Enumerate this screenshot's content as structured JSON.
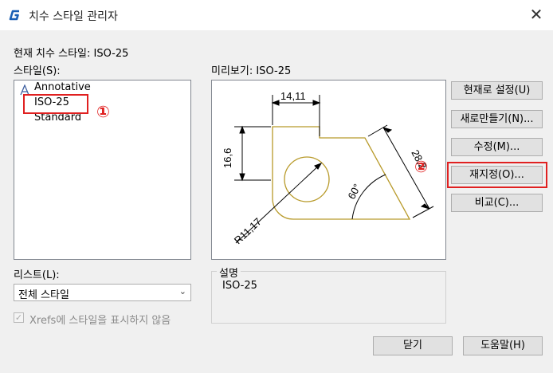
{
  "window": {
    "title": "치수 스타일 관리자",
    "close": "✕"
  },
  "current_style": "현재 치수 스타일: ISO-25",
  "styles_label": "스타일(S):",
  "styles": [
    "Annotative",
    "ISO-25",
    "Standard"
  ],
  "preview_label": "미리보기: ISO-25",
  "annotations": {
    "badge1": "①",
    "badge2": "②"
  },
  "drawing": {
    "dim_top": "14,11",
    "dim_left": "16,6",
    "dim_diag": "28,2",
    "angle": "60°",
    "radius": "R11,17"
  },
  "list_label": "리스트(L):",
  "list_value": "전체 스타일",
  "xrefs_label": "Xrefs에 스타일을 표시하지 않음",
  "description": {
    "legend": "설명",
    "text": "ISO-25"
  },
  "buttons": {
    "set_current": "현재로 설정(U)",
    "new": "새로만들기(N)...",
    "modify": "수정(M)...",
    "override": "재지정(O)...",
    "compare": "비교(C)...",
    "close": "닫기",
    "help": "도움말(H)"
  },
  "colors": {
    "highlight": "#e02020",
    "drawing": "#b89a2a"
  }
}
